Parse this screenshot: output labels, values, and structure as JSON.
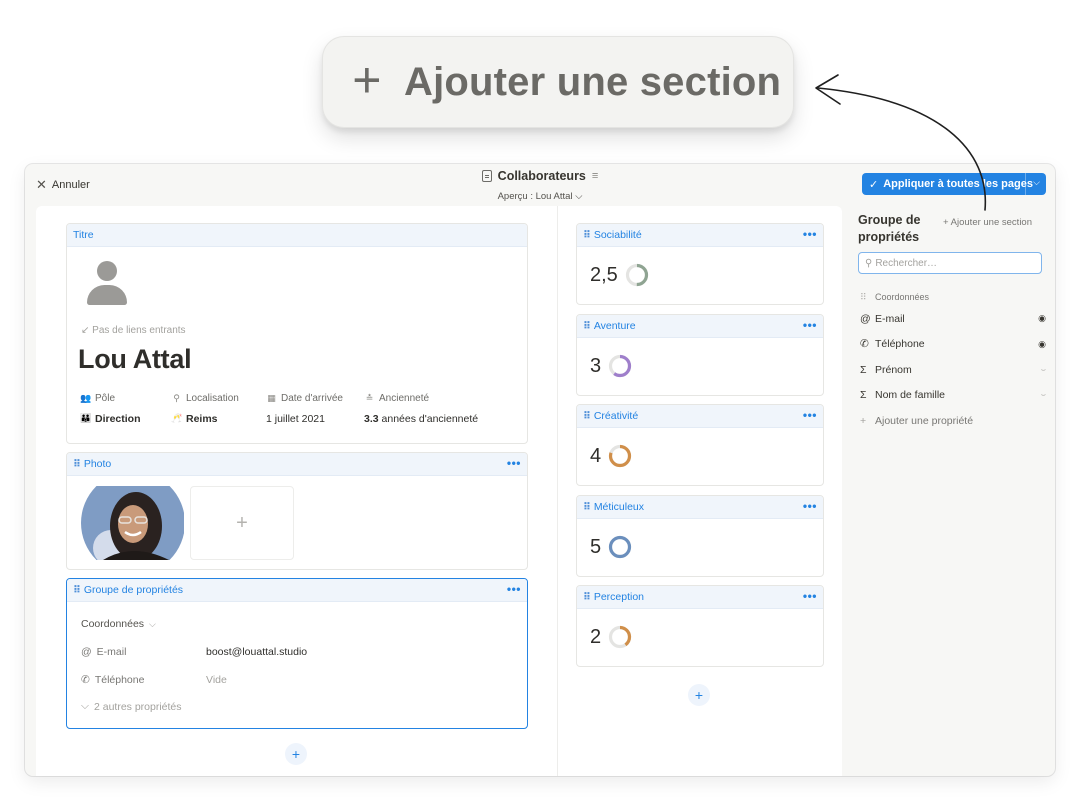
{
  "hero": {
    "label": "Ajouter une section",
    "icon": "plus-icon"
  },
  "topbar": {
    "cancel_label": "Annuler",
    "title": "Collaborateurs",
    "subtitle": "Aperçu : Lou Attal ⌵",
    "apply_label": "Appliquer à toutes les pages",
    "accent": "#2383e2"
  },
  "title_card": {
    "header": "Titre",
    "backlinks": "Pas de liens entrants",
    "name": "Lou Attal",
    "properties": [
      {
        "label": "Pôle",
        "value": "Direction",
        "icon": "people-icon"
      },
      {
        "label": "Localisation",
        "value": "Reims",
        "icon": "pin-icon"
      },
      {
        "label": "Date d'arrivée",
        "value": "1 juillet 2021",
        "icon": "calendar-icon"
      },
      {
        "label": "Ancienneté",
        "value_strong": "3.3",
        "value_rest": " années d'ancienneté",
        "icon": "stack-icon"
      }
    ]
  },
  "photo_card": {
    "header": "Photo",
    "add_label": "+"
  },
  "group_card": {
    "header": "Groupe de propriétés",
    "section_label": "Coordonnées",
    "rows": [
      {
        "key": "E-mail",
        "value": "boost@louattal.studio"
      },
      {
        "key": "Téléphone",
        "value": "Vide"
      }
    ],
    "more_label": "2 autres propriétés"
  },
  "metrics": [
    {
      "header": "Sociabilité",
      "value": "2,5",
      "level": 0.5,
      "color": "#8fa492"
    },
    {
      "header": "Aventure",
      "value": "3",
      "level": 0.6,
      "color": "#9f7fcb"
    },
    {
      "header": "Créativité",
      "value": "4",
      "level": 0.8,
      "color": "#d08f4a"
    },
    {
      "header": "Méticuleux",
      "value": "5",
      "level": 1.0,
      "color": "#6b8fbd"
    },
    {
      "header": "Perception",
      "value": "2",
      "level": 0.4,
      "color": "#d08f4a"
    }
  ],
  "panel": {
    "title": "Groupe de propriétés",
    "add_section": "+ Ajouter une section",
    "search_placeholder": "Rechercher…",
    "section": "Coordonnées",
    "items": [
      {
        "label": "E-mail",
        "icon": "@",
        "visible": true
      },
      {
        "label": "Téléphone",
        "icon": "✆",
        "visible": true
      },
      {
        "label": "Prénom",
        "icon": "Σ",
        "visible": false
      },
      {
        "label": "Nom de famille",
        "icon": "Σ",
        "visible": false
      }
    ],
    "add_property": "Ajouter une propriété"
  }
}
